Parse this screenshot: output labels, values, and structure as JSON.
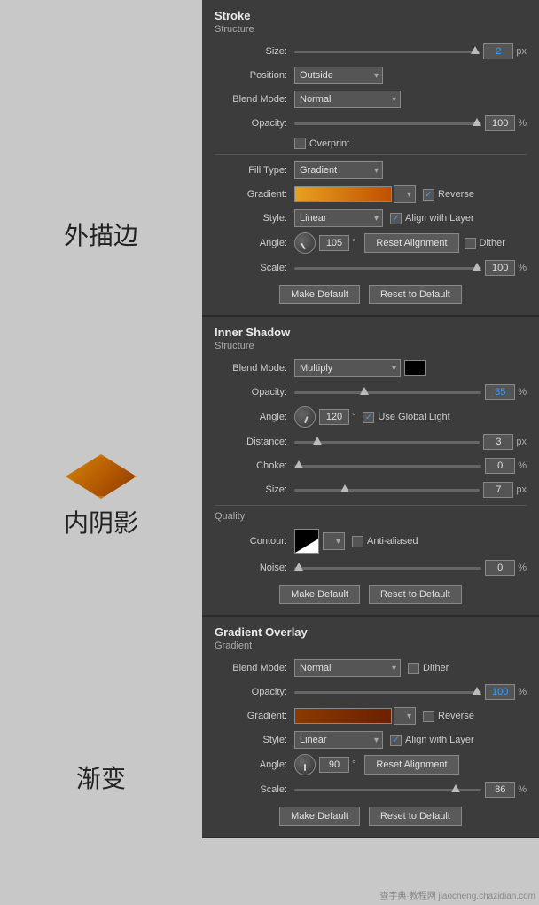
{
  "leftPanel": {
    "sections": [
      {
        "id": "stroke",
        "label": "外描边",
        "showShape": false
      },
      {
        "id": "innerShadow",
        "label": "内阴影",
        "showShape": true
      },
      {
        "id": "gradientOverlay",
        "label": "渐变",
        "showShape": false
      }
    ]
  },
  "strokePanel": {
    "title": "Stroke",
    "subtitle": "Structure",
    "size": "2",
    "sizeUnit": "px",
    "positionLabel": "Position:",
    "position": "Outside",
    "blendModeLabel": "Blend Mode:",
    "blendMode": "Normal",
    "opacityLabel": "Opacity:",
    "opacity": "100",
    "opacityUnit": "%",
    "overprintLabel": "Overprint",
    "fillTypeLabel": "Fill Type:",
    "fillType": "Gradient",
    "gradientLabel": "Gradient:",
    "reverseLabel": "Reverse",
    "styleLabel": "Style:",
    "style": "Linear",
    "alignWithLayerLabel": "Align with Layer",
    "angleLabel": "Angle:",
    "angleDeg": "105",
    "angleUnit": "°",
    "resetAlignmentLabel": "Reset Alignment",
    "ditherLabel": "Dither",
    "scaleLabel": "Scale:",
    "scale": "100",
    "scaleUnit": "%",
    "makeDefaultLabel": "Make Default",
    "resetToDefaultLabel": "Reset to Default"
  },
  "innerShadowPanel": {
    "title": "Inner Shadow",
    "subtitle": "Structure",
    "blendModeLabel": "Blend Mode:",
    "blendMode": "Multiply",
    "opacityLabel": "Opacity:",
    "opacity": "35",
    "opacityUnit": "%",
    "angleLabel": "Angle:",
    "angle": "120",
    "angleUnit": "°",
    "useGlobalLightLabel": "Use Global Light",
    "distanceLabel": "Distance:",
    "distance": "3",
    "distanceUnit": "px",
    "chokeLabel": "Choke:",
    "choke": "0",
    "chokeUnit": "%",
    "sizeLabel": "Size:",
    "size": "7",
    "sizeUnit": "px",
    "qualityLabel": "Quality",
    "contourLabel": "Contour:",
    "antiAliasedLabel": "Anti-aliased",
    "noiseLabel": "Noise:",
    "noise": "0",
    "noiseUnit": "%",
    "makeDefaultLabel": "Make Default",
    "resetToDefaultLabel": "Reset to Default"
  },
  "gradientOverlayPanel": {
    "title": "Gradient Overlay",
    "subtitle": "Gradient",
    "blendModeLabel": "Blend Mode:",
    "blendMode": "Normal",
    "ditherLabel": "Dither",
    "opacityLabel": "Opacity:",
    "opacity": "100",
    "opacityUnit": "%",
    "gradientLabel": "Gradient:",
    "reverseLabel": "Reverse",
    "styleLabel": "Style:",
    "style": "Linear",
    "alignWithLayerLabel": "Align with Layer",
    "angleLabel": "Angle:",
    "angle": "90",
    "angleUnit": "°",
    "resetAlignmentLabel": "Reset Alignment",
    "scaleLabel": "Scale:",
    "scale": "86",
    "scaleUnit": "%",
    "makeDefaultLabel": "Make Default",
    "resetToDefaultLabel": "Reset to Default"
  },
  "watermark": "查字典·教程网 jiaocheng.chazidian.com"
}
